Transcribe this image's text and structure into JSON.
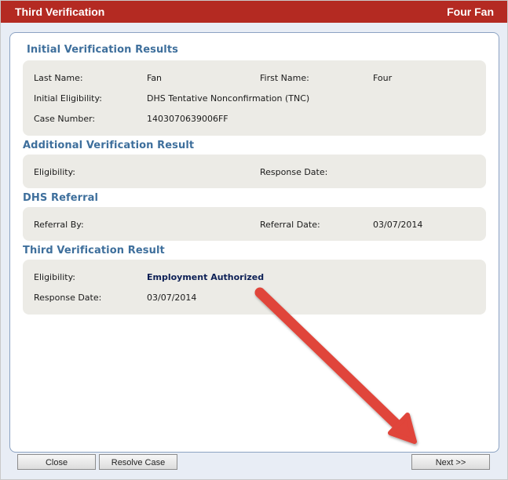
{
  "titlebar": {
    "title": "Third Verification",
    "user_name": "Four Fan"
  },
  "initial": {
    "heading": "Initial Verification Results",
    "last_name_label": "Last Name:",
    "last_name_value": "Fan",
    "first_name_label": "First Name:",
    "first_name_value": "Four",
    "eligibility_label": "Initial Eligibility:",
    "eligibility_value": "DHS Tentative Nonconfirmation (TNC)",
    "case_number_label": "Case Number:",
    "case_number_value": "1403070639006FF"
  },
  "additional": {
    "heading": "Additional Verification Result",
    "eligibility_label": "Eligibility:",
    "response_date_label": "Response Date:"
  },
  "referral": {
    "heading": "DHS Referral",
    "referral_by_label": "Referral By:",
    "referral_date_label": "Referral Date:",
    "referral_date_value": "03/07/2014"
  },
  "third": {
    "heading": "Third Verification Result",
    "eligibility_label": "Eligibility:",
    "eligibility_value": "Employment Authorized",
    "response_date_label": "Response Date:",
    "response_date_value": "03/07/2014"
  },
  "footer": {
    "close_label": "Close",
    "resolve_label": "Resolve Case",
    "next_label": "Next >>"
  },
  "colors": {
    "titlebar": "#b42a22",
    "section_heading": "#3e6f9c",
    "box_background": "#ecebe6",
    "annotation_arrow": "#e0443a"
  }
}
